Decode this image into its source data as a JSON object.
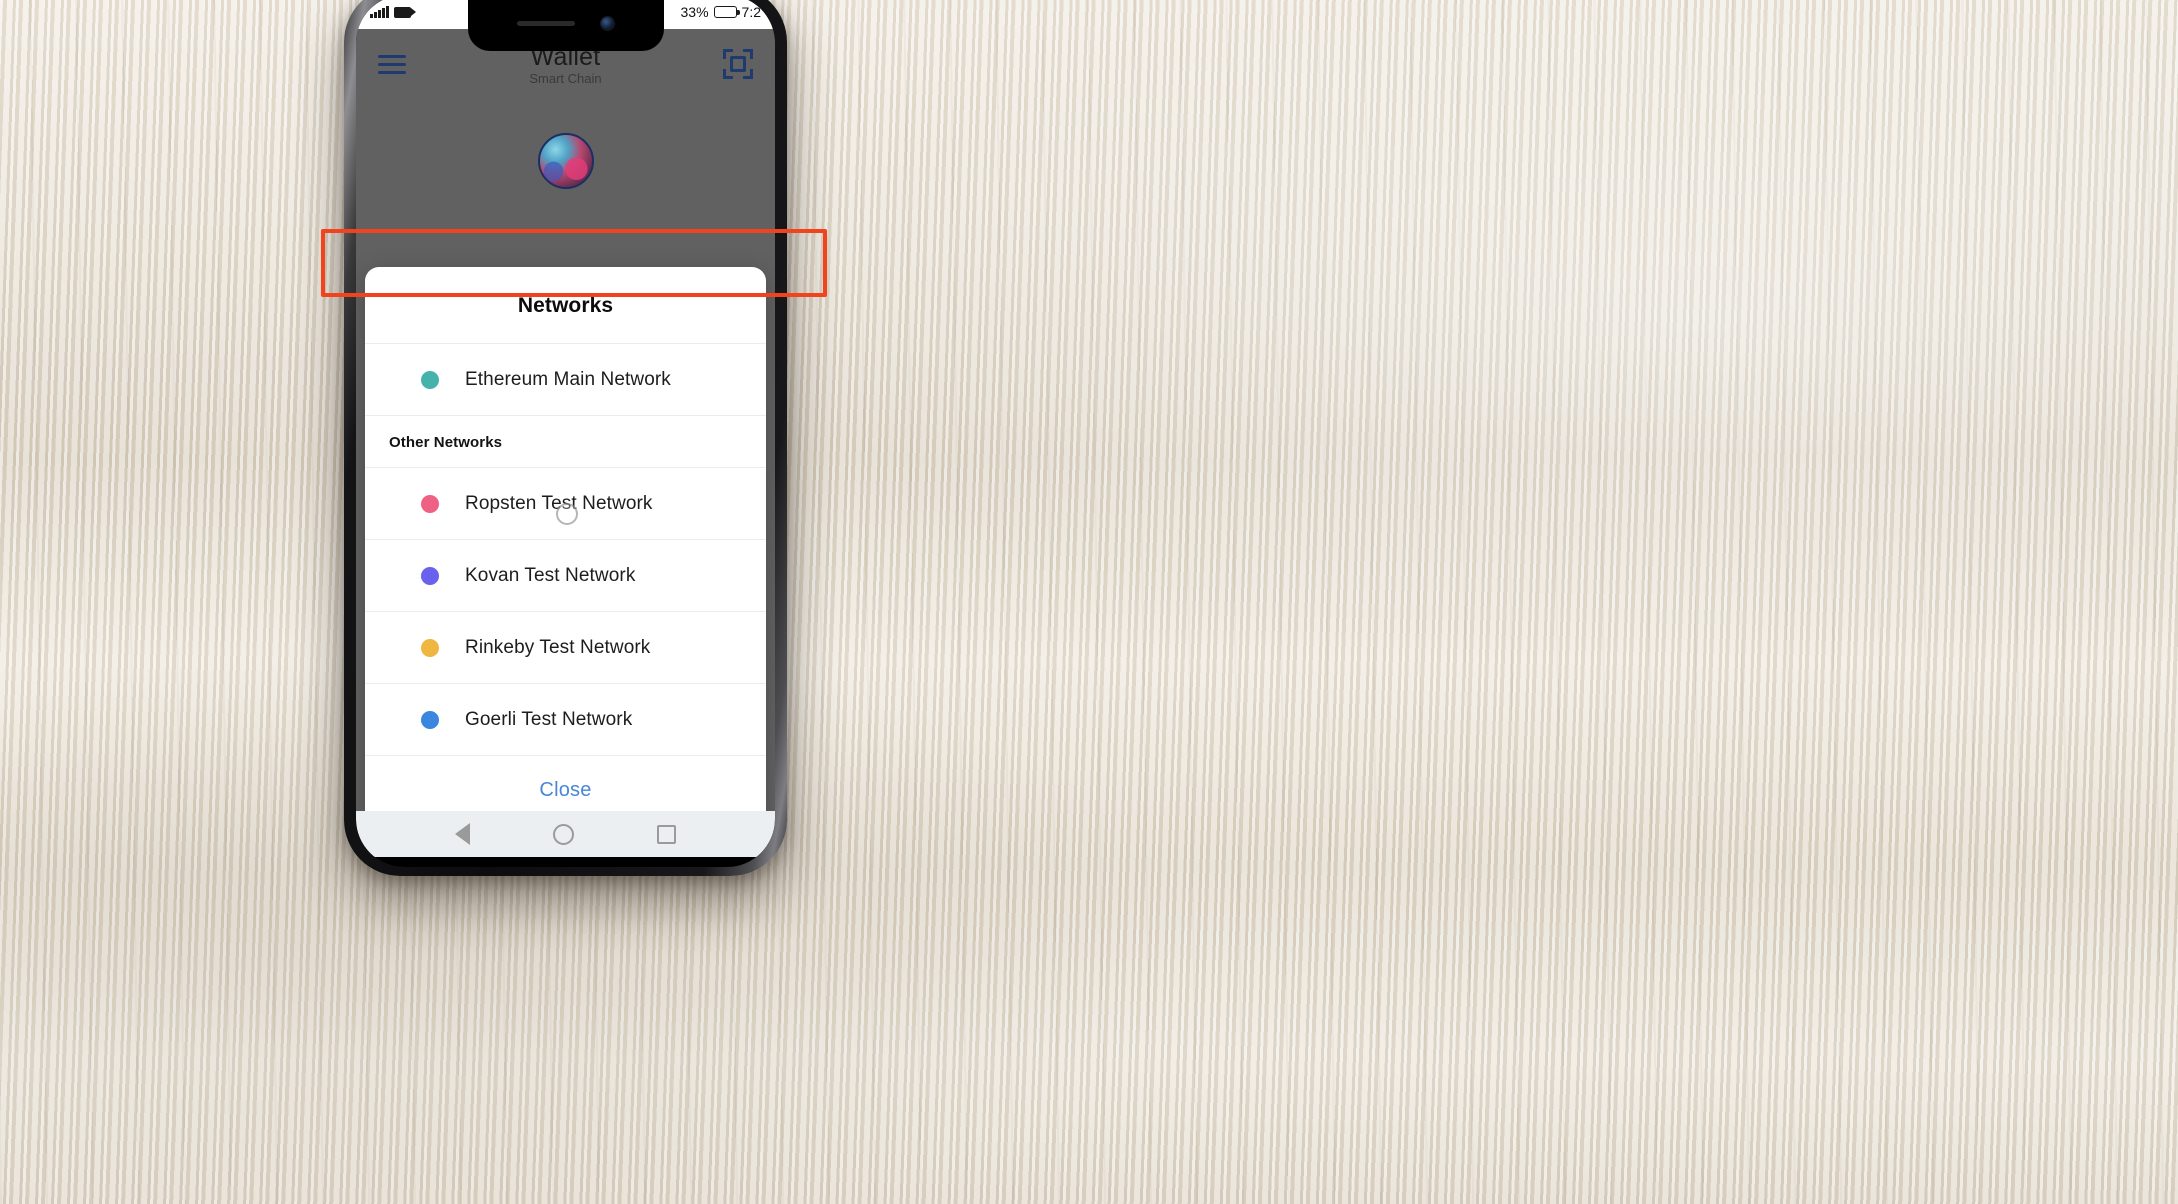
{
  "status_bar": {
    "signal_icon": "signal-bars-icon",
    "camera_icon": "video-camera-icon",
    "battery_percent": "33%",
    "battery_icon": "battery-icon",
    "time": "7:2"
  },
  "app_header": {
    "menu_icon": "hamburger-menu-icon",
    "title": "Wallet",
    "subtitle": "Smart Chain",
    "scan_icon": "qr-scan-icon"
  },
  "app_body": {
    "avatar_icon": "account-avatar-icon"
  },
  "modal": {
    "title": "Networks",
    "selected_network": {
      "label": "Ethereum Main Network",
      "dot_color": "#45b3ab"
    },
    "section_header": "Other Networks",
    "other_networks": [
      {
        "label": "Ropsten Test Network",
        "dot_color": "#ef6184"
      },
      {
        "label": "Kovan Test Network",
        "dot_color": "#6a62ec"
      },
      {
        "label": "Rinkeby Test Network",
        "dot_color": "#efb73f"
      },
      {
        "label": "Goerli Test Network",
        "dot_color": "#3a87e0"
      }
    ],
    "close_label": "Close",
    "close_color": "#4a86d8"
  },
  "annotation": {
    "highlight_color": "#f1441d",
    "highlight_target": "Ethereum Main Network"
  },
  "nav_bar": {
    "back_icon": "triangle-back-icon",
    "home_icon": "circle-home-icon",
    "recents_icon": "square-recents-icon"
  }
}
